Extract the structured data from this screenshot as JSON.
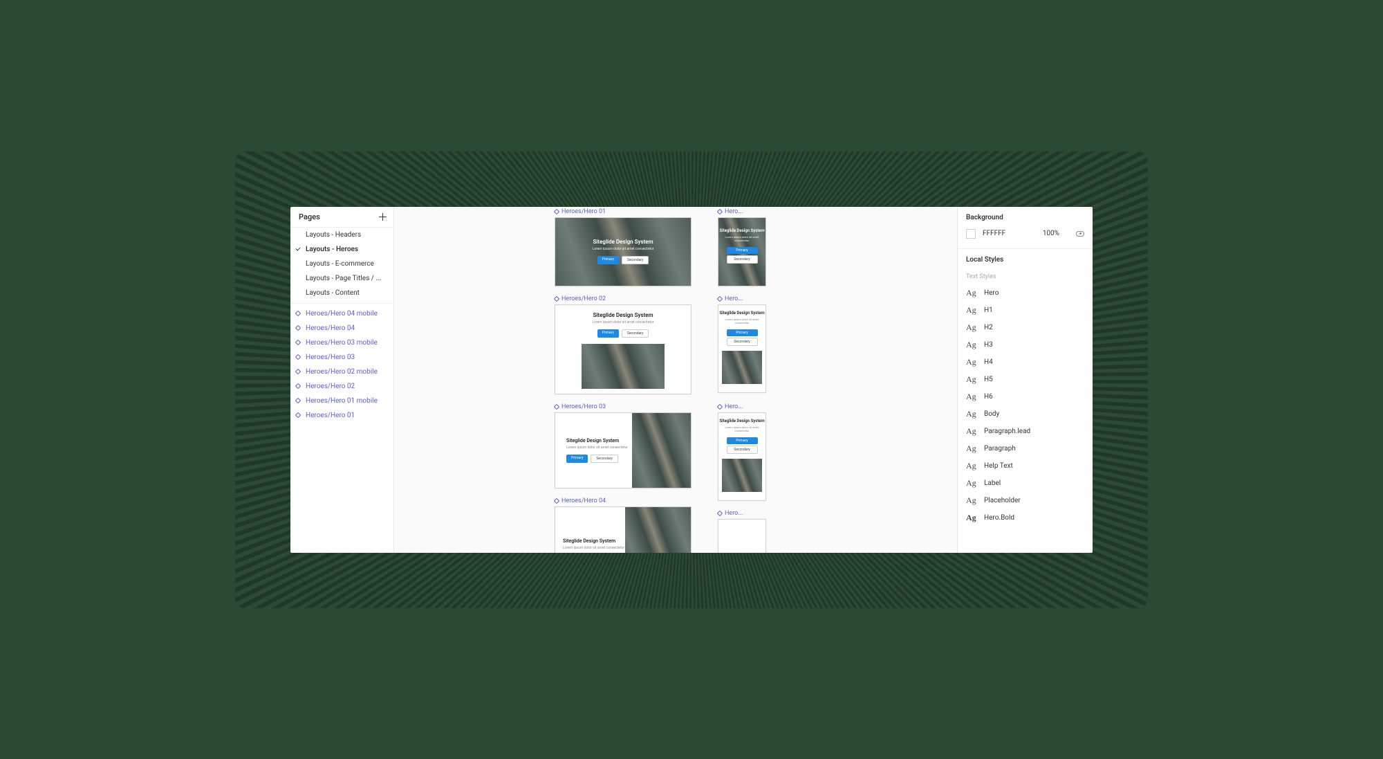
{
  "left": {
    "heading": "Pages",
    "pages": [
      {
        "label": "Layouts - Headers",
        "selected": false
      },
      {
        "label": "Layouts - Heroes",
        "selected": true
      },
      {
        "label": "Layouts - E-commerce",
        "selected": false
      },
      {
        "label": "Layouts - Page Titles / ...",
        "selected": false
      },
      {
        "label": "Layouts - Content",
        "selected": false
      }
    ],
    "frames": [
      {
        "label": "Heroes/Hero 04 mobile"
      },
      {
        "label": "Heroes/Hero 04"
      },
      {
        "label": "Heroes/Hero 03 mobile"
      },
      {
        "label": "Heroes/Hero 03"
      },
      {
        "label": "Heroes/Hero 02 mobile"
      },
      {
        "label": "Heroes/Hero 02"
      },
      {
        "label": "Heroes/Hero 01 mobile"
      },
      {
        "label": "Heroes/Hero 01"
      }
    ]
  },
  "canvas": {
    "hero_title": "Siteglide Design System",
    "hero_sub": "Lorem ipsum dolor sit amet consectetur",
    "btn_primary": "Primary",
    "btn_ghost": "Secondary",
    "frames_wide": [
      {
        "label": "Heroes/Hero 01"
      },
      {
        "label": "Heroes/Hero 02"
      },
      {
        "label": "Heroes/Hero 03"
      },
      {
        "label": "Heroes/Hero 04"
      }
    ],
    "frames_narrow": [
      {
        "label": "Hero..."
      },
      {
        "label": "Hero..."
      },
      {
        "label": "Hero..."
      },
      {
        "label": "Hero..."
      }
    ]
  },
  "right": {
    "background_heading": "Background",
    "bg_hex": "FFFFFF",
    "bg_opacity": "100%",
    "local_styles_heading": "Local Styles",
    "text_styles_subhead": "Text Styles",
    "styles": [
      {
        "name": "Hero",
        "bold": false
      },
      {
        "name": "H1",
        "bold": false
      },
      {
        "name": "H2",
        "bold": false
      },
      {
        "name": "H3",
        "bold": false
      },
      {
        "name": "H4",
        "bold": false
      },
      {
        "name": "H5",
        "bold": false
      },
      {
        "name": "H6",
        "bold": false
      },
      {
        "name": "Body",
        "bold": false
      },
      {
        "name": "Paragraph.lead",
        "bold": false
      },
      {
        "name": "Paragraph",
        "bold": false
      },
      {
        "name": "Help Text",
        "bold": false
      },
      {
        "name": "Label",
        "bold": false
      },
      {
        "name": "Placeholder",
        "bold": false
      },
      {
        "name": "Hero.Bold",
        "bold": true
      }
    ]
  }
}
